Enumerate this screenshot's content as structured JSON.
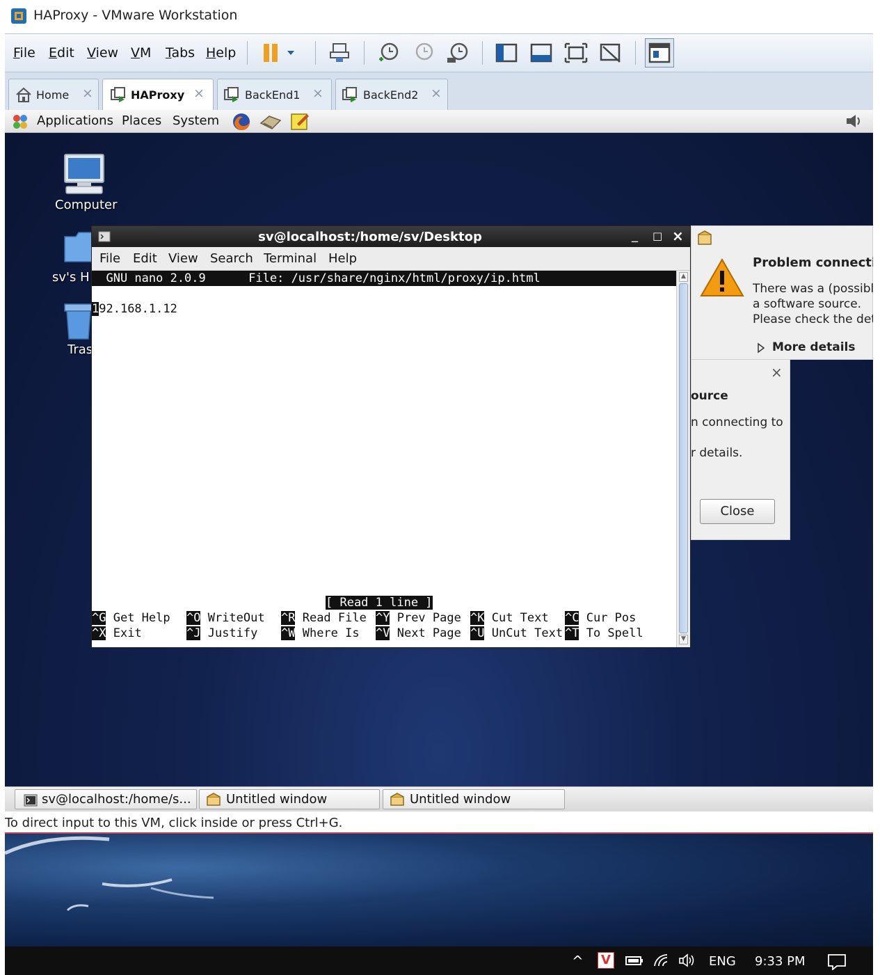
{
  "window": {
    "title": "HAProxy - VMware Workstation"
  },
  "vm_menu": [
    "File",
    "Edit",
    "View",
    "VM",
    "Tabs",
    "Help"
  ],
  "vm_tabs": [
    {
      "label": "Home",
      "active": false
    },
    {
      "label": "HAProxy",
      "active": true
    },
    {
      "label": "BackEnd1",
      "active": false
    },
    {
      "label": "BackEnd2",
      "active": false
    }
  ],
  "guest_panel": {
    "menus": [
      "Applications",
      "Places",
      "System"
    ]
  },
  "desktop_icons": [
    {
      "label": "Computer"
    },
    {
      "label": "sv's H"
    },
    {
      "label": "Tras"
    }
  ],
  "terminal": {
    "title": "sv@localhost:/home/sv/Desktop",
    "menu": [
      "File",
      "Edit",
      "View",
      "Search",
      "Terminal",
      "Help"
    ],
    "nano_header": "  GNU nano 2.0.9      File: /usr/share/nginx/html/proxy/ip.html",
    "cursor_char": "1",
    "content_line": "92.168.1.12",
    "status": "[ Read 1 line ]",
    "shortcuts_row1": [
      {
        "key": "^G",
        "label": "Get Help"
      },
      {
        "key": "^O",
        "label": "WriteOut"
      },
      {
        "key": "^R",
        "label": "Read File"
      },
      {
        "key": "^Y",
        "label": "Prev Page"
      },
      {
        "key": "^K",
        "label": "Cut Text"
      },
      {
        "key": "^C",
        "label": "Cur Pos"
      }
    ],
    "shortcuts_row2": [
      {
        "key": "^X",
        "label": "Exit"
      },
      {
        "key": "^J",
        "label": "Justify"
      },
      {
        "key": "^W",
        "label": "Where Is"
      },
      {
        "key": "^V",
        "label": "Next Page"
      },
      {
        "key": "^U",
        "label": "UnCut Text"
      },
      {
        "key": "^T",
        "label": "To Spell"
      }
    ]
  },
  "notification": {
    "title": "Problem connecti",
    "line1": "There was a (possibl",
    "line2": "a software source.",
    "line3": "Please check the det",
    "more_details": "More details",
    "back_title": "ource",
    "back_line1": "n connecting to",
    "back_line2": "r details.",
    "close_label": "Close"
  },
  "guest_taskbar": [
    {
      "label": "sv@localhost:/home/s..."
    },
    {
      "label": "Untitled window"
    },
    {
      "label": "Untitled window"
    }
  ],
  "vm_status": "To direct input to this VM, click inside or press Ctrl+G.",
  "host_tray": {
    "language": "ENG",
    "time": "9:33 PM"
  },
  "colors": {
    "vm_accent": "#d6e0ec",
    "warning": "#f39c12",
    "terminal_inverse": "#111111"
  }
}
